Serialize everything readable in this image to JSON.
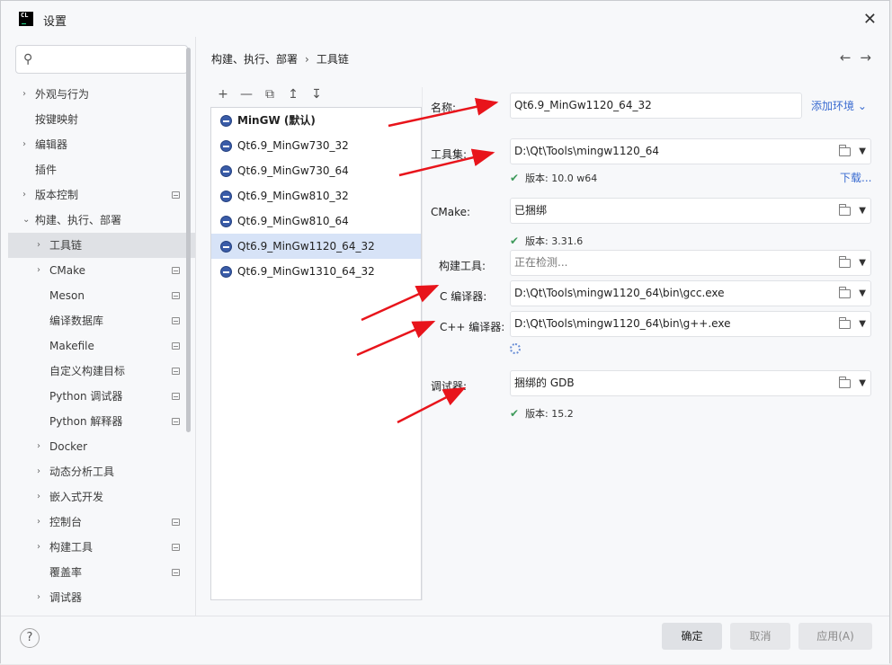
{
  "window": {
    "title": "设置",
    "app_icon": "CL"
  },
  "search": {
    "placeholder": ""
  },
  "sidebar": {
    "items": [
      {
        "label": "外观与行为",
        "chevron": "›",
        "level": 0
      },
      {
        "label": "按键映射",
        "chevron": "",
        "level": 0
      },
      {
        "label": "编辑器",
        "chevron": "›",
        "level": 0
      },
      {
        "label": "插件",
        "chevron": "",
        "level": 0
      },
      {
        "label": "版本控制",
        "chevron": "›",
        "level": 0,
        "badge": true
      },
      {
        "label": "构建、执行、部署",
        "chevron": "⌄",
        "level": 0
      },
      {
        "label": "工具链",
        "chevron": "›",
        "level": 1,
        "selected": true
      },
      {
        "label": "CMake",
        "chevron": "›",
        "level": 1,
        "badge": true
      },
      {
        "label": "Meson",
        "chevron": "",
        "level": 1,
        "badge": true
      },
      {
        "label": "编译数据库",
        "chevron": "",
        "level": 1,
        "badge": true
      },
      {
        "label": "Makefile",
        "chevron": "",
        "level": 1,
        "badge": true
      },
      {
        "label": "自定义构建目标",
        "chevron": "",
        "level": 1,
        "badge": true
      },
      {
        "label": "Python 调试器",
        "chevron": "",
        "level": 1,
        "badge": true
      },
      {
        "label": "Python 解释器",
        "chevron": "",
        "level": 1,
        "badge": true
      },
      {
        "label": "Docker",
        "chevron": "›",
        "level": 1
      },
      {
        "label": "动态分析工具",
        "chevron": "›",
        "level": 1
      },
      {
        "label": "嵌入式开发",
        "chevron": "›",
        "level": 1
      },
      {
        "label": "控制台",
        "chevron": "›",
        "level": 1,
        "badge": true
      },
      {
        "label": "构建工具",
        "chevron": "›",
        "level": 1,
        "badge": true
      },
      {
        "label": "覆盖率",
        "chevron": "",
        "level": 1,
        "badge": true
      },
      {
        "label": "调试器",
        "chevron": "›",
        "level": 1
      }
    ]
  },
  "breadcrumb": {
    "parent": "构建、执行、部署",
    "sep": "›",
    "current": "工具链"
  },
  "nav": {
    "back": "←",
    "forward": "→"
  },
  "list_toolbar": {
    "add": "+",
    "remove": "—",
    "copy": "⧉",
    "up": "↥",
    "down": "↧"
  },
  "toolchains": [
    {
      "name": "MinGW (默认)",
      "bold": true
    },
    {
      "name": "Qt6.9_MinGw730_32"
    },
    {
      "name": "Qt6.9_MinGw730_64"
    },
    {
      "name": "Qt6.9_MinGw810_32"
    },
    {
      "name": "Qt6.9_MinGw810_64"
    },
    {
      "name": "Qt6.9_MinGw1120_64_32",
      "selected": true
    },
    {
      "name": "Qt6.9_MinGw1310_64_32"
    }
  ],
  "form": {
    "name_label": "名称:",
    "name_value": "Qt6.9_MinGw1120_64_32",
    "add_env": "添加环境 ⌄",
    "toolset_label": "工具集:",
    "toolset_value": "D:\\Qt\\Tools\\mingw1120_64",
    "toolset_version": "版本: 10.0 w64",
    "download": "下载...",
    "cmake_label": "CMake:",
    "cmake_value": "已捆绑",
    "cmake_version": "版本: 3.31.6",
    "build_tool_label": "构建工具:",
    "build_tool_value": "正在检测...",
    "c_compiler_label": "C 编译器:",
    "c_compiler_value": "D:\\Qt\\Tools\\mingw1120_64\\bin\\gcc.exe",
    "cpp_compiler_label": "C++ 编译器:",
    "cpp_compiler_value": "D:\\Qt\\Tools\\mingw1120_64\\bin\\g++.exe",
    "debugger_label": "调试器:",
    "debugger_value": "捆绑的 GDB",
    "debugger_version": "版本: 15.2",
    "check_mark": "✔"
  },
  "footer": {
    "help": "?",
    "ok": "确定",
    "cancel": "取消",
    "apply": "应用(A)"
  },
  "colors": {
    "accent": "#3a6bd0",
    "annotation_arrow": "#e8141b",
    "ok_check": "#3e9a5b",
    "selection": "#d7e3f7"
  }
}
